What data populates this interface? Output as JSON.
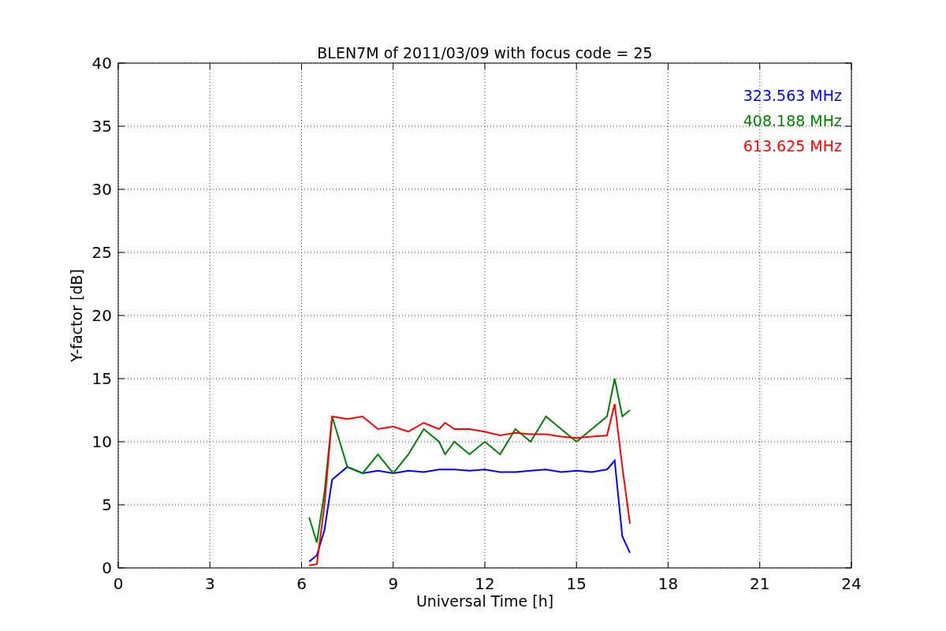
{
  "chart_data": {
    "type": "line",
    "title": "BLEN7M of 2011/03/09 with focus code = 25",
    "xlabel": "Universal Time [h]",
    "ylabel": "Y-factor [dB]",
    "x": [
      6.25,
      6.5,
      6.75,
      7,
      7.5,
      8,
      8.5,
      9,
      9.5,
      10,
      10.5,
      10.7,
      11,
      11.5,
      12,
      12.5,
      13,
      13.5,
      14,
      14.5,
      15,
      15.5,
      16,
      16.25,
      16.5,
      16.75
    ],
    "series": [
      {
        "name": "323.563 MHz",
        "color": "#0000ff",
        "values": [
          0.5,
          1,
          3,
          7,
          8,
          7.5,
          7.7,
          7.5,
          7.7,
          7.6,
          7.8,
          7.8,
          7.8,
          7.7,
          7.8,
          7.6,
          7.6,
          7.7,
          7.8,
          7.6,
          7.7,
          7.6,
          7.8,
          8.5,
          2.5,
          1.2
        ]
      },
      {
        "name": "408.188 MHz",
        "color": "#008000",
        "values": [
          4,
          2,
          6,
          12,
          8,
          7.5,
          9,
          7.5,
          9,
          11,
          10,
          9,
          10,
          9,
          10,
          9,
          11,
          10,
          12,
          11,
          10,
          11,
          12,
          15,
          12,
          12.5
        ]
      },
      {
        "name": "613.625 MHz",
        "color": "#ff0000",
        "values": [
          0.2,
          0.3,
          5,
          12,
          11.8,
          12,
          11,
          11.2,
          10.8,
          11.5,
          11,
          11.5,
          11,
          11,
          10.8,
          10.5,
          10.7,
          10.6,
          10.6,
          10.4,
          10.3,
          10.4,
          10.5,
          13,
          8,
          3.5
        ]
      }
    ],
    "xlim": [
      0,
      24
    ],
    "ylim": [
      0,
      40
    ],
    "xticks": [
      0,
      3,
      6,
      9,
      12,
      15,
      18,
      21,
      24
    ],
    "yticks": [
      0,
      5,
      10,
      15,
      20,
      25,
      30,
      35,
      40
    ],
    "grid": true
  }
}
